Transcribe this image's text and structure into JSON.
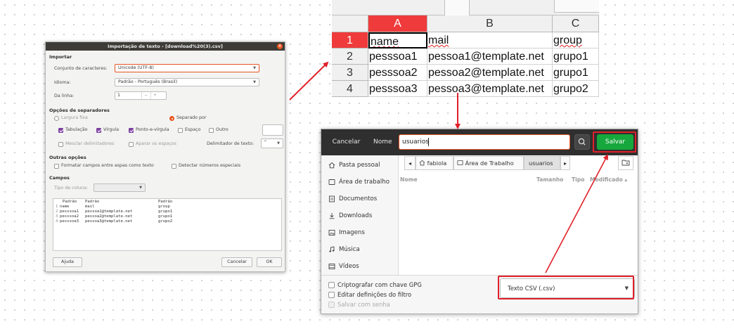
{
  "import_dialog": {
    "title": "Importação de texto - [download%20(3).csv]",
    "close_glyph": "×",
    "sections": {
      "import": "Importar",
      "separator_options": "Opções de separadores",
      "other_options": "Outras opções",
      "fields": "Campos"
    },
    "charset_label": "Conjunto de caracteres:",
    "charset_value": "Unicode (UTF-8)",
    "language_label": "Idioma:",
    "language_value": "Padrão - Português (Brasil)",
    "from_row_label": "Da linha:",
    "from_row_value": "1",
    "fixed_width": "Largura fixa",
    "separated_by": "Separado por",
    "tab": "Tabulação",
    "comma": "Vírgula",
    "semicolon": "Ponto-e-vírgula",
    "space": "Espaço",
    "other": "Outro",
    "merge_delimiters": "Mesclar delimitadores",
    "trim_spaces": "Aparar os espaços",
    "text_delimiter_label": "Delimitador de texto:",
    "text_delimiter_value": "\"",
    "quoted_as_text": "Formatar campos entre aspas como texto",
    "detect_special_numbers": "Detectar números especiais",
    "column_type_label": "Tipo de coluna:",
    "preview": {
      "headers": [
        "Padrão",
        "Padrão",
        "Padrão"
      ],
      "rows": [
        [
          "1",
          "name",
          "mail",
          "group"
        ],
        [
          "2",
          "pesssoa1",
          "pessoa1@template.net",
          "grupo1"
        ],
        [
          "3",
          "pesssoa2",
          "pessoa2@template.net",
          "grupo1"
        ],
        [
          "4",
          "pesssoa3",
          "pessoa3@template.net",
          "grupo2"
        ]
      ]
    },
    "help_button": "Ajuda",
    "cancel_button": "Cancelar",
    "ok_button": "OK"
  },
  "spreadsheet": {
    "columns": [
      "A",
      "B",
      "C"
    ],
    "rows": [
      {
        "num": "1",
        "cells": [
          "name",
          "mail",
          "group"
        ]
      },
      {
        "num": "2",
        "cells": [
          "pesssoa1",
          "pessoa1@template.net",
          "grupo1"
        ]
      },
      {
        "num": "3",
        "cells": [
          "pesssoa2",
          "pessoa2@template.net",
          "grupo1"
        ]
      },
      {
        "num": "4",
        "cells": [
          "pesssoa3",
          "pessoa3@template.net",
          "grupo2"
        ]
      }
    ]
  },
  "save_dialog": {
    "cancel_button": "Cancelar",
    "name_label": "Nome",
    "filename_value": "usuarios",
    "save_button": "Salvar",
    "sidebar": [
      {
        "icon": "home-icon",
        "label": "Pasta pessoal"
      },
      {
        "icon": "desktop-icon",
        "label": "Área de trabalho"
      },
      {
        "icon": "documents-icon",
        "label": "Documentos"
      },
      {
        "icon": "downloads-icon",
        "label": "Downloads"
      },
      {
        "icon": "images-icon",
        "label": "Imagens"
      },
      {
        "icon": "music-icon",
        "label": "Música"
      },
      {
        "icon": "videos-icon",
        "label": "Vídeos"
      }
    ],
    "path": [
      "fabiola",
      "Área de Trabalho",
      "usuarios"
    ],
    "columns": {
      "name": "Nome",
      "size": "Tamanho",
      "type": "Tipo",
      "modified": "Modificado"
    },
    "encrypt_gpg": "Criptografar com chave GPG",
    "edit_filter": "Editar definições do filtro",
    "save_with_password": "Salvar com senha",
    "file_type": "Texto CSV (.csv)"
  },
  "colors": {
    "annotation_red": "#e0202a",
    "save_green": "#16a83c",
    "ubuntu_orange": "#e95420",
    "selected_header_red": "#ef3b3b"
  }
}
